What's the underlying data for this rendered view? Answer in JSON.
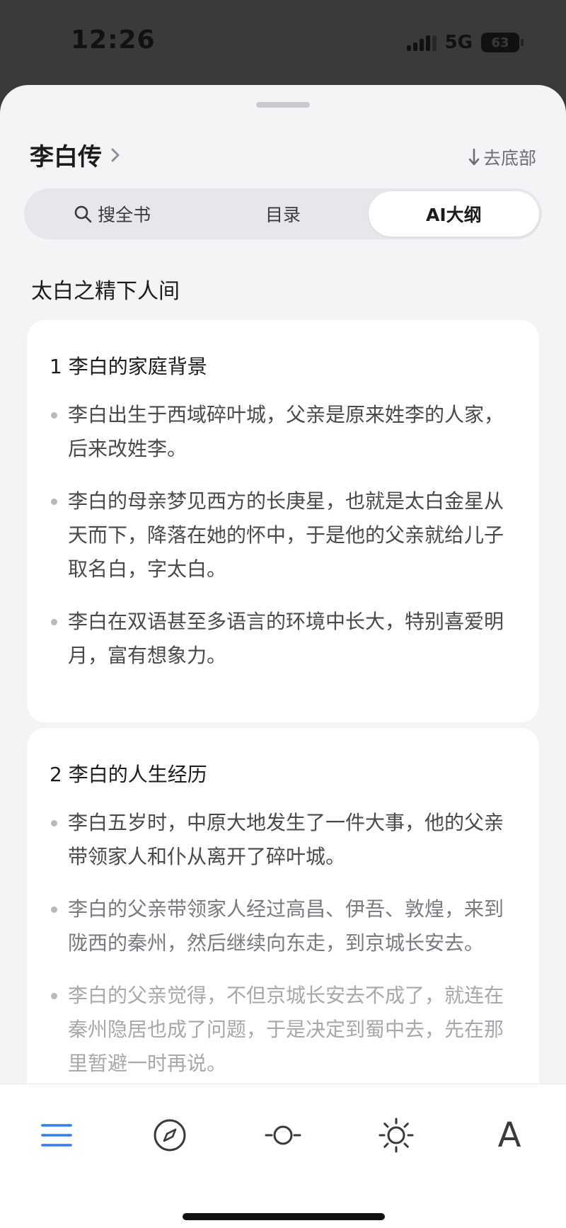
{
  "status_bar": {
    "time": "12:26",
    "network": "5G",
    "battery": "63"
  },
  "header": {
    "book_title": "李白传",
    "to_bottom_label": "去底部"
  },
  "tabs": [
    {
      "label": "搜全书",
      "icon": "search-icon",
      "active": false
    },
    {
      "label": "目录",
      "active": false
    },
    {
      "label": "AI大纲",
      "active": true
    }
  ],
  "outline": {
    "heading": "太白之精下人间",
    "sections": [
      {
        "title": "1 李白的家庭背景",
        "bullets": [
          "李白出生于西域碎叶城，父亲是原来姓李的人家，后来改姓李。",
          "李白的母亲梦见西方的长庚星，也就是太白金星从天而下，降落在她的怀中，于是他的父亲就给儿子取名白，字太白。",
          "李白在双语甚至多语言的环境中长大，特别喜爱明月，富有想象力。"
        ]
      },
      {
        "title": "2 李白的人生经历",
        "bullets": [
          "李白五岁时，中原大地发生了一件大事，他的父亲带领家人和仆从离开了碎叶城。",
          "李白的父亲带领家人经过高昌、伊吾、敦煌，来到陇西的秦州，然后继续向东走，到京城长安去。",
          "李白的父亲觉得，不但京城长安去不成了，就连在秦州隐居也成了问题，于是决定到蜀中去，先在那里暂避一时再说。"
        ]
      }
    ]
  },
  "toolbar": {
    "items": [
      "menu-icon",
      "compass-icon",
      "progress-icon",
      "brightness-icon",
      "font-size-icon"
    ],
    "font_glyph": "A",
    "accent_color": "#2f7bf5"
  }
}
